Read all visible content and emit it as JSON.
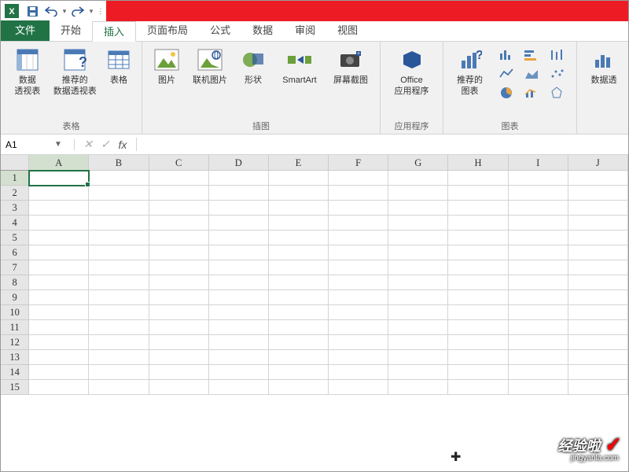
{
  "qat": {
    "app": "Excel"
  },
  "tabs": {
    "file": "文件",
    "home": "开始",
    "insert": "插入",
    "pagelayout": "页面布局",
    "formulas": "公式",
    "data": "数据",
    "review": "审阅",
    "view": "视图"
  },
  "ribbon": {
    "groups": {
      "tables": {
        "label": "表格",
        "pivot": "数据\n透视表",
        "recpivot": "推荐的\n数据透视表",
        "table": "表格"
      },
      "illustrations": {
        "label": "插图",
        "picture": "图片",
        "online": "联机图片",
        "shapes": "形状",
        "smartart": "SmartArt",
        "screenshot": "屏幕截图"
      },
      "apps": {
        "label": "应用程序",
        "office": "Office\n应用程序"
      },
      "charts": {
        "label": "图表",
        "recchart": "推荐的\n图表"
      },
      "pivot_right": {
        "label": "数据透"
      }
    }
  },
  "namebox": {
    "value": "A1"
  },
  "formula": {
    "value": ""
  },
  "columns": [
    "A",
    "B",
    "C",
    "D",
    "E",
    "F",
    "G",
    "H",
    "I",
    "J"
  ],
  "rows": [
    "1",
    "2",
    "3",
    "4",
    "5",
    "6",
    "7",
    "8",
    "9",
    "10",
    "11",
    "12",
    "13",
    "14",
    "15"
  ],
  "active": {
    "col": "A",
    "row": "1"
  },
  "watermark": {
    "main": "经验啦",
    "sub": "jingyanla.com"
  }
}
